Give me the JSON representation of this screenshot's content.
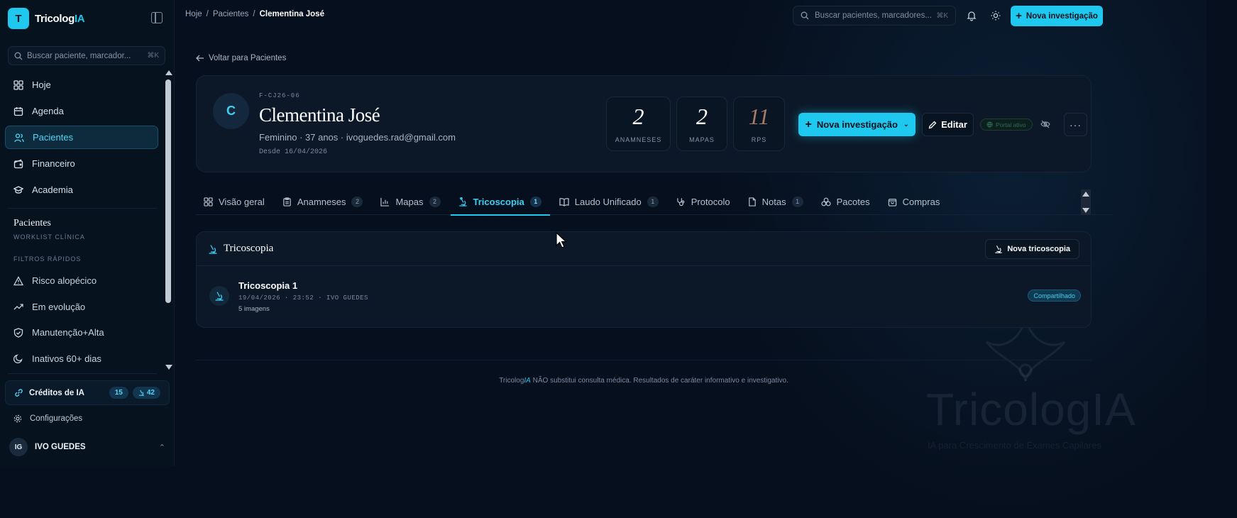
{
  "app": {
    "logo_letter": "T",
    "name_main": "Tricolog",
    "name_accent": "IA"
  },
  "sidebar": {
    "search_placeholder": "Buscar paciente, marcador...",
    "search_shortcut": "⌘K",
    "nav": [
      {
        "label": "Hoje",
        "icon": "grid-icon"
      },
      {
        "label": "Agenda",
        "icon": "calendar-icon"
      },
      {
        "label": "Pacientes",
        "icon": "users-icon",
        "active": true
      },
      {
        "label": "Financeiro",
        "icon": "wallet-icon"
      },
      {
        "label": "Academia",
        "icon": "graduation-cap-icon"
      }
    ],
    "section_title": "Pacientes",
    "section_subtitle": "WORKLIST CLÍNICA",
    "filters_title": "FILTROS RÁPIDOS",
    "filters": [
      {
        "label": "Risco alopécico",
        "icon": "warning-icon"
      },
      {
        "label": "Em evolução",
        "icon": "trending-up-icon"
      },
      {
        "label": "Manutenção+Alta",
        "icon": "shield-check-icon"
      },
      {
        "label": "Inativos 60+ dias",
        "icon": "moon-icon"
      }
    ],
    "credits_label": "Créditos de IA",
    "credits_a": "15",
    "credits_b": "42",
    "config_label": "Configurações",
    "user_initials": "IG",
    "user_name": "IVO GUEDES"
  },
  "topbar": {
    "breadcrumb": [
      "Hoje",
      "/",
      "Pacientes",
      "/",
      "Clementina José"
    ],
    "search_placeholder": "Buscar pacientes, marcadores...",
    "search_shortcut": "⌘K",
    "new_button": "Nova investigação"
  },
  "back_link": "Voltar para Pacientes",
  "patient": {
    "initial": "C",
    "code": "F-CJ26-06",
    "name": "Clementina José",
    "info": "Feminino · 37 anos · ivoguedes.rad@gmail.com",
    "since": "Desde 16/04/2026",
    "stats": [
      {
        "value": "2",
        "label": "ANAMNESES"
      },
      {
        "value": "2",
        "label": "MAPAS"
      },
      {
        "value": "11",
        "label": "RPS"
      }
    ],
    "new_button": "Nova investigação",
    "edit_button": "Editar",
    "portal_label": "Portal ativo",
    "more": "···"
  },
  "tabs": [
    {
      "label": "Visão geral",
      "icon": "grid-icon",
      "badge": ""
    },
    {
      "label": "Anamneses",
      "icon": "clipboard-icon",
      "badge": "2"
    },
    {
      "label": "Mapas",
      "icon": "bar-chart-icon",
      "badge": "2"
    },
    {
      "label": "Tricoscopia",
      "icon": "microscope-icon",
      "badge": "1",
      "active": true
    },
    {
      "label": "Laudo Unificado",
      "icon": "book-open-icon",
      "badge": "1"
    },
    {
      "label": "Protocolo",
      "icon": "stethoscope-icon",
      "badge": ""
    },
    {
      "label": "Notas",
      "icon": "file-icon",
      "badge": "1"
    },
    {
      "label": "Pacotes",
      "icon": "boxes-icon",
      "badge": ""
    },
    {
      "label": "Compras",
      "icon": "shopping-bag-icon",
      "badge": ""
    }
  ],
  "panel": {
    "title": "Tricoscopia",
    "new_button": "Nova tricoscopia",
    "rows": [
      {
        "title": "Tricoscopia 1",
        "meta": "19/04/2026 · 23:52 · IVO GUEDES",
        "count": "5 imagens",
        "status": "Compartilhado"
      }
    ]
  },
  "footer": {
    "brand_main": "Tricolog",
    "brand_accent": "IA",
    "text": " NÃO substitui consulta médica. Resultados de caráter informativo e investigativo."
  },
  "watermark": {
    "word": "TricologIA",
    "tagline": "IA para Crescimento de Exames Capilares"
  },
  "colors": {
    "accent": "#1ec8ef",
    "background": "#060f1d",
    "card": "#0c1828"
  }
}
